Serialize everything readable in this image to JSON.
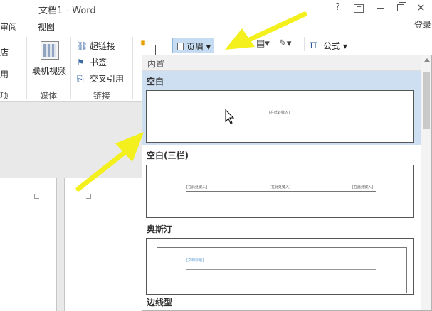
{
  "window": {
    "title": "文档1 - Word",
    "help": "?",
    "close": "✕"
  },
  "tabs": {
    "review": "审阅",
    "view": "视图",
    "signin": "登录"
  },
  "ribbon": {
    "store_partial": "店",
    "apps_partial": "用",
    "online_video": "联机视频",
    "hyperlink": "超链接",
    "bookmark": "书签",
    "cross_reference": "交叉引用",
    "group_partial": "项",
    "group_media": "媒体",
    "group_links": "链接",
    "header_button": "页眉",
    "formula": "公式",
    "pi_symbol": "π"
  },
  "header_gallery": {
    "section": "内置",
    "items": [
      {
        "name": "空白",
        "placeholders": [
          "[在此处键入]"
        ]
      },
      {
        "name": "空白(三栏)",
        "placeholders": [
          "[在此处键入]",
          "[在此处键入]",
          "[在此处键入]"
        ]
      },
      {
        "name": "奥斯汀",
        "placeholders": [
          "[文档标题]"
        ]
      },
      {
        "name": "边线型",
        "placeholders": []
      }
    ]
  },
  "colors": {
    "selected_item": "#cfdff2",
    "header_button_bg": "#c5dcf2",
    "arrow": "#f3f01e"
  }
}
